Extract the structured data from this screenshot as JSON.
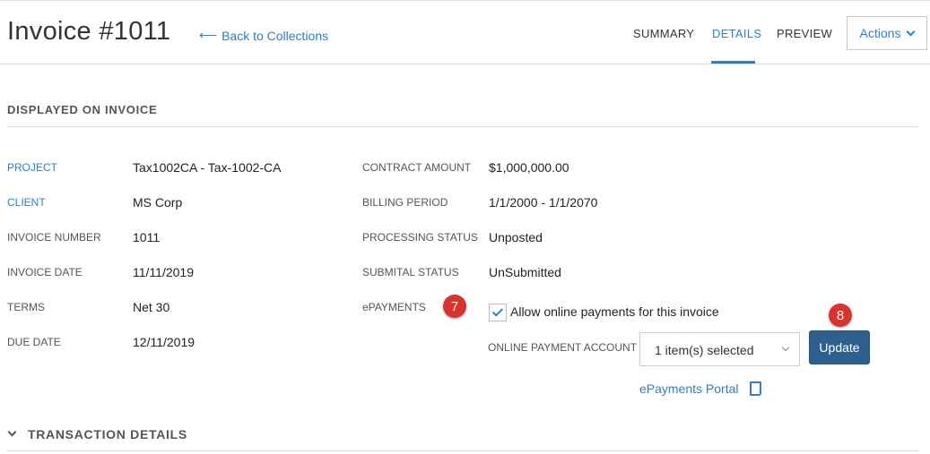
{
  "header": {
    "title": "Invoice #1011",
    "back_link": "Back to Collections",
    "tabs": [
      {
        "label": "SUMMARY",
        "active": false
      },
      {
        "label": "DETAILS",
        "active": true
      },
      {
        "label": "PREVIEW",
        "active": false
      }
    ],
    "actions_label": "Actions"
  },
  "colors": {
    "accent": "#2f7fc1",
    "primary_button": "#2d5f8f",
    "badge": "#d9342b"
  },
  "displayed_on_invoice": {
    "section_title": "DISPLAYED ON INVOICE",
    "left_fields": [
      {
        "label": "PROJECT",
        "value": "Tax1002CA - Tax-1002-CA",
        "link": true
      },
      {
        "label": "CLIENT",
        "value": "MS Corp",
        "link": true
      },
      {
        "label": "INVOICE NUMBER",
        "value": "1011",
        "link": false
      },
      {
        "label": "INVOICE DATE",
        "value": "11/11/2019",
        "link": false
      },
      {
        "label": "TERMS",
        "value": "Net 30",
        "link": false
      },
      {
        "label": "DUE DATE",
        "value": "12/11/2019",
        "link": false
      }
    ],
    "right_fields": [
      {
        "label": "CONTRACT AMOUNT",
        "value": "$1,000,000.00"
      },
      {
        "label": "BILLING PERIOD",
        "value": "1/1/2000 - 1/1/2070"
      },
      {
        "label": "PROCESSING STATUS",
        "value": "Unposted"
      },
      {
        "label": "SUBMITAL STATUS",
        "value": "UnSubmitted"
      }
    ],
    "epayments": {
      "label": "ePAYMENTS",
      "allow_label": "Allow online payments for this invoice",
      "allow_checked": true,
      "account_label": "ONLINE PAYMENT ACCOUNT",
      "account_value": "1 item(s) selected",
      "update_label": "Update",
      "portal_label": "ePayments Portal"
    }
  },
  "annotations": {
    "badge_7": "7",
    "badge_8": "8"
  },
  "transaction_details": {
    "section_title": "TRANSACTION DETAILS"
  }
}
